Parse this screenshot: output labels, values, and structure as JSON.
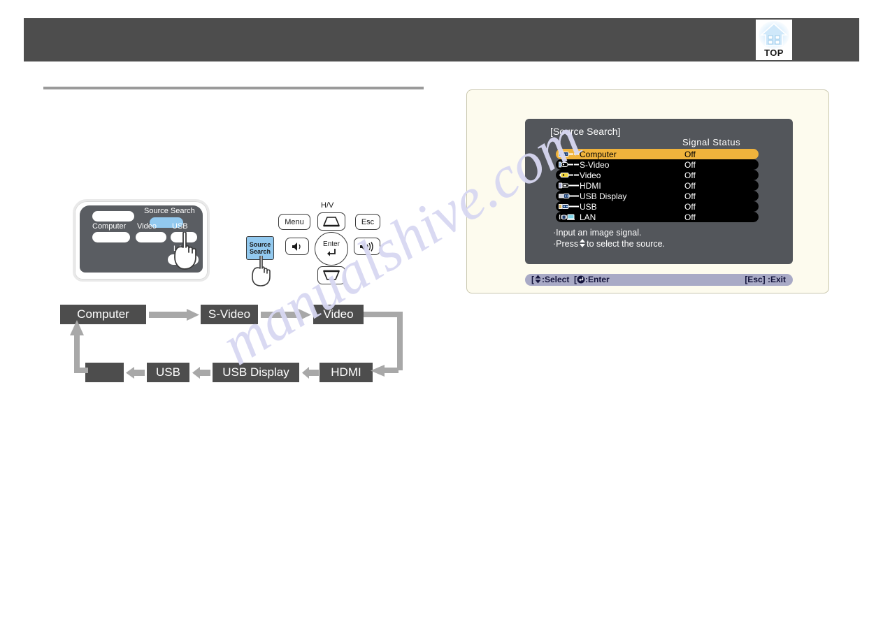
{
  "page": {
    "watermark": "manualshive.com",
    "header_color": "#4d4d4d",
    "panel_bg_color": "#fdfbee",
    "highlight_color": "#f0b33c"
  },
  "header": {
    "top_button_label": "TOP",
    "top_button_icon": "house-icon"
  },
  "control_panel_figure": {
    "buttons": [
      {
        "label": "Source Search",
        "icon": "source-search-button",
        "highlighted": true
      },
      {
        "label": "Computer",
        "icon": "computer-source-button",
        "highlighted": false
      },
      {
        "label": "Video",
        "icon": "video-source-button",
        "highlighted": false
      },
      {
        "label": "USB",
        "icon": "usb-source-button",
        "highlighted": false
      },
      {
        "label": "LAN",
        "icon": "lan-source-button",
        "highlighted": false
      }
    ]
  },
  "remote_figure": {
    "keys": [
      {
        "label": "Menu",
        "name": "menu-key"
      },
      {
        "label": "H/V",
        "name": "hv-keystone-label"
      },
      {
        "label": "Esc",
        "name": "esc-key"
      },
      {
        "label": "Source Search",
        "name": "source-search-key",
        "highlighted": true
      },
      {
        "label": "Enter",
        "name": "enter-key"
      }
    ],
    "source_search_line1": "Source",
    "source_search_line2": "Search",
    "enter_label": "Enter",
    "menu_label": "Menu",
    "esc_label": "Esc",
    "hv_label": "H/V"
  },
  "flow_diagram": {
    "top_row": [
      "Computer",
      "S-Video",
      "Video"
    ],
    "bottom_row": [
      "",
      "USB",
      "USB Display",
      "HDMI"
    ],
    "box_color": "#4d4d4d",
    "arrow_color": "#a8a8a8"
  },
  "osd": {
    "title": "[Source Search]",
    "signal_status_header": "Signal Status",
    "sources": [
      {
        "name": "Computer",
        "status": "Off",
        "icon": "computer-port-icon",
        "selected": true
      },
      {
        "name": "S-Video",
        "status": "Off",
        "icon": "svideo-port-icon",
        "selected": false
      },
      {
        "name": "Video",
        "status": "Off",
        "icon": "video-rca-port-icon",
        "selected": false
      },
      {
        "name": "HDMI",
        "status": "Off",
        "icon": "hdmi-port-icon",
        "selected": false
      },
      {
        "name": "USB Display",
        "status": "Off",
        "icon": "usb-display-port-icon",
        "selected": false
      },
      {
        "name": "USB",
        "status": "Off",
        "icon": "usb-port-icon",
        "selected": false
      },
      {
        "name": "LAN",
        "status": "Off",
        "icon": "lan-wireless-icon",
        "selected": false
      }
    ],
    "hint_line_1": "·Input an image signal.",
    "hint_line_2_prefix": "·Press",
    "hint_line_2_suffix": "to select the source.",
    "footer_left": "[♦] :Select  [↵] :Enter",
    "footer_left_select": ":Select",
    "footer_left_enter": ":Enter",
    "footer_right": "[Esc] :Exit"
  }
}
